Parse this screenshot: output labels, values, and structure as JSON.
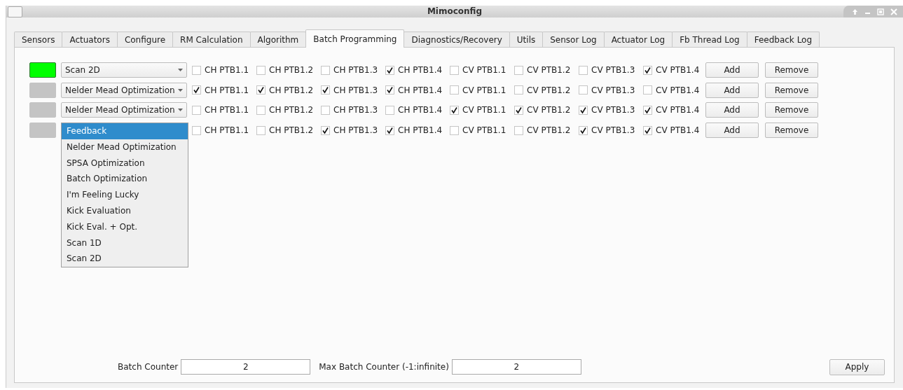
{
  "window": {
    "title": "Mimoconfig"
  },
  "tabs": [
    {
      "label": "Sensors",
      "selected": false
    },
    {
      "label": "Actuators",
      "selected": false
    },
    {
      "label": "Configure",
      "selected": false
    },
    {
      "label": "RM Calculation",
      "selected": false
    },
    {
      "label": "Algorithm",
      "selected": false
    },
    {
      "label": "Batch Programming",
      "selected": true
    },
    {
      "label": "Diagnostics/Recovery",
      "selected": false
    },
    {
      "label": "Utils",
      "selected": false
    },
    {
      "label": "Sensor Log",
      "selected": false
    },
    {
      "label": "Actuator Log",
      "selected": false
    },
    {
      "label": "Fb Thread Log",
      "selected": false
    },
    {
      "label": "Feedback Log",
      "selected": false
    }
  ],
  "rows": [
    {
      "active": true,
      "algorithm": "Scan 2D",
      "checks": [
        {
          "label": "CH PTB1.1",
          "checked": false
        },
        {
          "label": "CH PTB1.2",
          "checked": false
        },
        {
          "label": "CH PTB1.3",
          "checked": false
        },
        {
          "label": "CH PTB1.4",
          "checked": true
        },
        {
          "label": "CV PTB1.1",
          "checked": false
        },
        {
          "label": "CV PTB1.2",
          "checked": false
        },
        {
          "label": "CV PTB1.3",
          "checked": false
        },
        {
          "label": "CV PTB1.4",
          "checked": true
        }
      ],
      "buttons": [
        "Add",
        "Remove"
      ]
    },
    {
      "active": false,
      "algorithm": "Nelder Mead Optimization",
      "checks": [
        {
          "label": "CH PTB1.1",
          "checked": true
        },
        {
          "label": "CH PTB1.2",
          "checked": true
        },
        {
          "label": "CH PTB1.3",
          "checked": true
        },
        {
          "label": "CH PTB1.4",
          "checked": true
        },
        {
          "label": "CV PTB1.1",
          "checked": false
        },
        {
          "label": "CV PTB1.2",
          "checked": false
        },
        {
          "label": "CV PTB1.3",
          "checked": false
        },
        {
          "label": "CV PTB1.4",
          "checked": false
        }
      ],
      "buttons": [
        "Add",
        "Remove"
      ]
    },
    {
      "active": false,
      "algorithm": "Nelder Mead Optimization",
      "checks": [
        {
          "label": "CH PTB1.1",
          "checked": false
        },
        {
          "label": "CH PTB1.2",
          "checked": false
        },
        {
          "label": "CH PTB1.3",
          "checked": false
        },
        {
          "label": "CH PTB1.4",
          "checked": false
        },
        {
          "label": "CV PTB1.1",
          "checked": true
        },
        {
          "label": "CV PTB1.2",
          "checked": true
        },
        {
          "label": "CV PTB1.3",
          "checked": true
        },
        {
          "label": "CV PTB1.4",
          "checked": true
        }
      ],
      "buttons": [
        "Add",
        "Remove"
      ]
    },
    {
      "active": false,
      "checks": [
        {
          "label": "CH PTB1.1",
          "checked": false
        },
        {
          "label": "CH PTB1.2",
          "checked": false
        },
        {
          "label": "CH PTB1.3",
          "checked": true
        },
        {
          "label": "CH PTB1.4",
          "checked": true
        },
        {
          "label": "CV PTB1.1",
          "checked": false
        },
        {
          "label": "CV PTB1.2",
          "checked": false
        },
        {
          "label": "CV PTB1.3",
          "checked": true
        },
        {
          "label": "CV PTB1.4",
          "checked": true
        }
      ],
      "buttons": [
        "Add",
        "Remove"
      ],
      "dropdown": [
        {
          "label": "Feedback",
          "selected": true
        },
        {
          "label": "Nelder Mead Optimization",
          "selected": false
        },
        {
          "label": "SPSA Optimization",
          "selected": false
        },
        {
          "label": "Batch Optimization",
          "selected": false
        },
        {
          "label": "I'm Feeling Lucky",
          "selected": false
        },
        {
          "label": "Kick Evaluation",
          "selected": false
        },
        {
          "label": "Kick Eval. + Opt.",
          "selected": false
        },
        {
          "label": "Scan 1D",
          "selected": false
        },
        {
          "label": "Scan 2D",
          "selected": false
        }
      ]
    }
  ],
  "footer": {
    "batch_counter": {
      "label": "Batch Counter",
      "value": "2"
    },
    "max_batch_counter": {
      "label": "Max Batch Counter (-1:infinite)",
      "value": "2"
    },
    "apply": "Apply"
  }
}
